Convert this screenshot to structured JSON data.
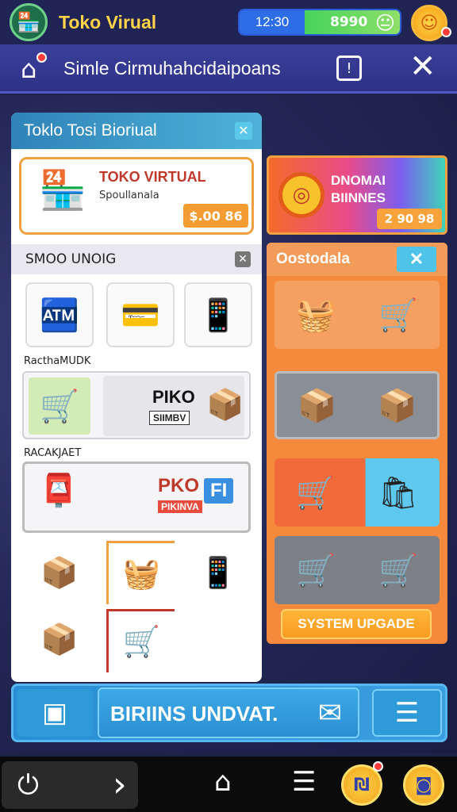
{
  "header": {
    "logo_icon": "🏪",
    "app_title": "Toko Virual",
    "time": "12:30",
    "balance": "8990",
    "face_icon": "😐",
    "coin_icon": "☺"
  },
  "nav": {
    "home_icon": "⌂",
    "title": "Simle Cirmuhahcidaipoans",
    "info_icon": "!",
    "close_icon": "✕"
  },
  "left_panel": {
    "title": "Toklo Tosi Bioriual",
    "close_icon": "✕",
    "hero": {
      "title": "TOKO VIRTUAL",
      "subtitle": "Spoullanala",
      "price": "$.00 86",
      "icon": "🏪"
    },
    "section1_title": "SMOO UNOIG",
    "section1_close": "✕",
    "tiles": [
      "🏧",
      "💳",
      "📱"
    ],
    "caption1": "RacthaMUDK",
    "banner1": {
      "cart_icon": "🛒",
      "text1": "PIKO",
      "text2": "SIIMBV",
      "pkg_icon": "📦"
    },
    "caption2": "RACAKJAET",
    "banner2": {
      "box_icon": "📮",
      "text1": "PKO",
      "text2": "PIKINVA",
      "text3": "FI"
    },
    "items": [
      "📦",
      "🧺",
      "📱",
      "📦",
      "🛒"
    ]
  },
  "promo": {
    "icon": "◎",
    "title_line1": "DNOMAI",
    "title_line2": "BIINNES",
    "price": "2 90 98"
  },
  "right_panel": {
    "title": "Oostodala",
    "close_icon": "✕",
    "rows": [
      [
        "🧺",
        "🛒"
      ],
      [
        "📦",
        "📦"
      ],
      [
        "🛒",
        "🛍"
      ],
      [
        "🛒",
        "🛒"
      ]
    ],
    "upgrade_label": "SYSTEM UPGADE"
  },
  "bonus_bar": {
    "left_icon": "▣",
    "text": "BIRIINS UNDVAT.",
    "mail_icon": "✉",
    "right_icon": "☰"
  },
  "system_bar": {
    "power_icon": "⏻",
    "forward_icon": "›",
    "home_icon": "⌂",
    "menu_icon": "☰",
    "gold1_icon": "₪",
    "gold2_icon": "◙"
  }
}
